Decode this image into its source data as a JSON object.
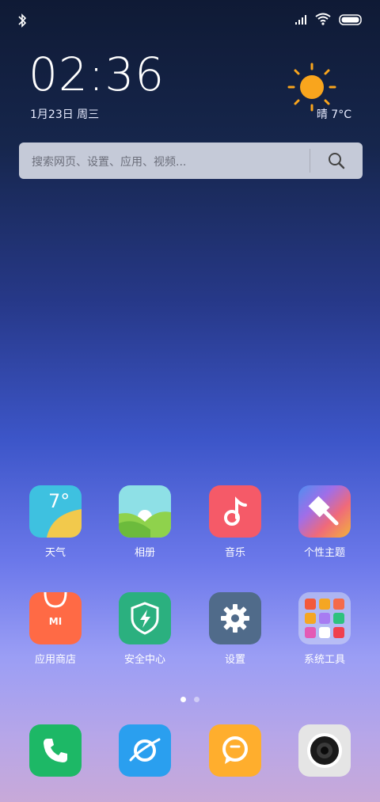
{
  "status_bar": {
    "bluetooth_icon": "bluetooth-icon",
    "signal_icon": "signal-icon",
    "wifi_icon": "wifi-icon",
    "battery_icon": "battery-icon"
  },
  "clock": {
    "time": "02:36",
    "date": "1月23日 周三"
  },
  "weather": {
    "icon": "sun-icon",
    "text": "晴 7°C"
  },
  "search": {
    "placeholder": "搜索网页、设置、应用、视频...",
    "icon": "search-icon"
  },
  "apps": [
    {
      "label": "天气",
      "icon": "weather-app-icon",
      "badge": "7°"
    },
    {
      "label": "相册",
      "icon": "gallery-icon"
    },
    {
      "label": "音乐",
      "icon": "music-icon"
    },
    {
      "label": "个性主题",
      "icon": "themes-icon"
    },
    {
      "label": "应用商店",
      "icon": "app-store-icon",
      "badge": "MI"
    },
    {
      "label": "安全中心",
      "icon": "security-icon"
    },
    {
      "label": "设置",
      "icon": "settings-icon"
    },
    {
      "label": "系统工具",
      "icon": "folder-icon"
    }
  ],
  "page_indicator": {
    "pages": 2,
    "current": 1
  },
  "dock": [
    {
      "name": "phone",
      "icon": "phone-icon"
    },
    {
      "name": "browser",
      "icon": "browser-icon"
    },
    {
      "name": "messages",
      "icon": "messages-icon"
    },
    {
      "name": "camera",
      "icon": "camera-icon"
    }
  ],
  "colors": {
    "weather": "#3ec1e0",
    "gallery": "#8fd24c",
    "music": "#f55a68",
    "themes": "#f0a63a",
    "store": "#ff6a45",
    "security": "#2bb07f",
    "settings": "#506b8a",
    "folder": "#d6dcf5",
    "phone": "#1db866",
    "browser": "#2a9fef",
    "messages": "#ffae2d",
    "camera": "#e5e5e5"
  }
}
